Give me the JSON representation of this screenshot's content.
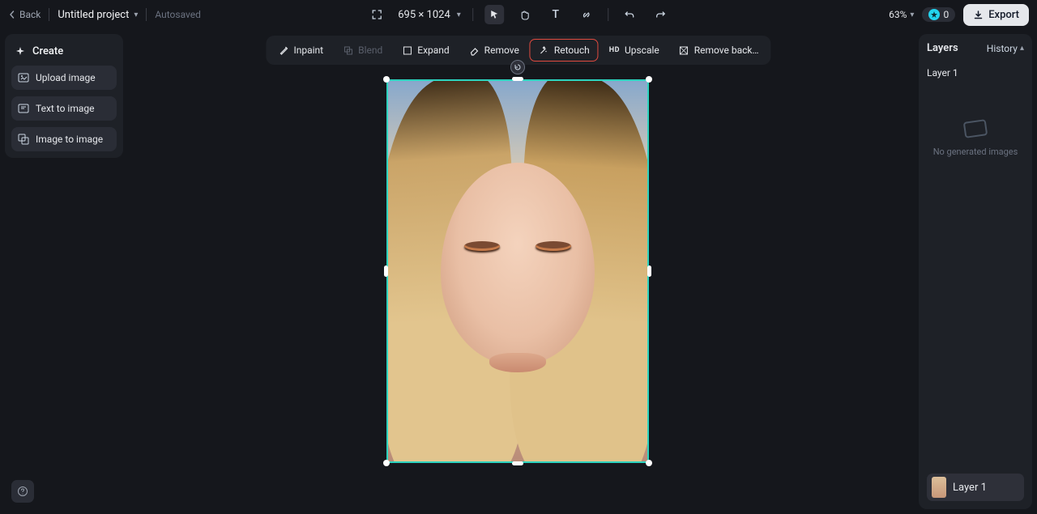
{
  "header": {
    "back_label": "Back",
    "project_name": "Untitled project",
    "autosaved_label": "Autosaved",
    "dimensions": "695 × 1024",
    "zoom_pct": "63%",
    "credits": "0",
    "export_label": "Export"
  },
  "sidebar": {
    "create_label": "Create",
    "items": [
      {
        "label": "Upload image"
      },
      {
        "label": "Text to image"
      },
      {
        "label": "Image to image"
      }
    ]
  },
  "toolbar": {
    "inpaint": "Inpaint",
    "blend": "Blend",
    "expand": "Expand",
    "remove": "Remove",
    "retouch": "Retouch",
    "upscale": "Upscale",
    "remove_bg": "Remove back…"
  },
  "right": {
    "layers_label": "Layers",
    "history_label": "History",
    "layer_static": "Layer 1",
    "empty_msg": "No generated images",
    "selected_layer": "Layer 1"
  }
}
